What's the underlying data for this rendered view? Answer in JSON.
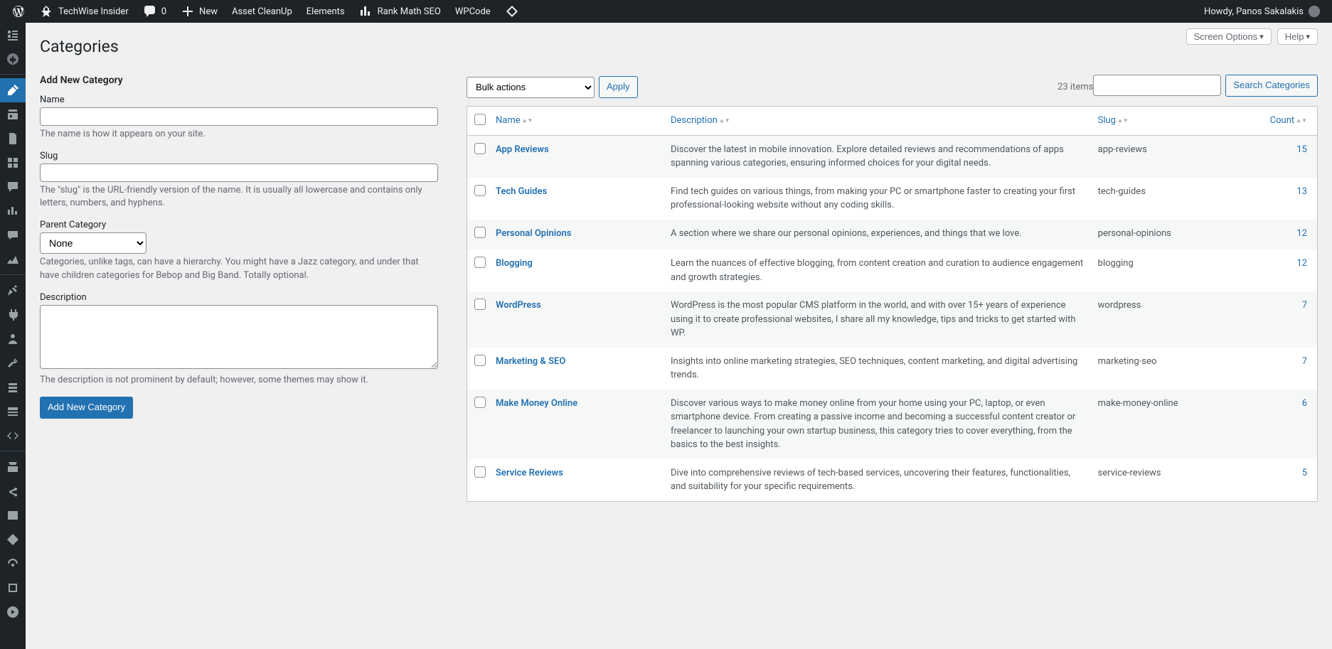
{
  "adminbar": {
    "site": "TechWise Insider",
    "comments": "0",
    "new": "New",
    "asset_cleanup": "Asset CleanUp",
    "elements": "Elements",
    "rankmath": "Rank Math SEO",
    "wpcode": "WPCode",
    "howdy": "Howdy, Panos Sakalakis"
  },
  "screen": {
    "options": "Screen Options",
    "help": "Help"
  },
  "page": {
    "title": "Categories",
    "search_btn": "Search Categories",
    "items_count": "23 items"
  },
  "form": {
    "heading": "Add New Category",
    "name_label": "Name",
    "name_desc": "The name is how it appears on your site.",
    "slug_label": "Slug",
    "slug_desc": "The \"slug\" is the URL-friendly version of the name. It is usually all lowercase and contains only letters, numbers, and hyphens.",
    "parent_label": "Parent Category",
    "parent_value": "None",
    "parent_desc": "Categories, unlike tags, can have a hierarchy. You might have a Jazz category, and under that have children categories for Bebop and Big Band. Totally optional.",
    "desc_label": "Description",
    "desc_desc": "The description is not prominent by default; however, some themes may show it.",
    "submit": "Add New Category"
  },
  "bulk": {
    "select": "Bulk actions",
    "apply": "Apply"
  },
  "cols": {
    "name": "Name",
    "description": "Description",
    "slug": "Slug",
    "count": "Count"
  },
  "rows": [
    {
      "name": "App Reviews",
      "desc": "Discover the latest in mobile innovation. Explore detailed reviews and recommendations of apps spanning various categories, ensuring informed choices for your digital needs.",
      "slug": "app-reviews",
      "count": "15"
    },
    {
      "name": "Tech Guides",
      "desc": "Find tech guides on various things, from making your PC or smartphone faster to creating your first professional-looking website without any coding skills.",
      "slug": "tech-guides",
      "count": "13"
    },
    {
      "name": "Personal Opinions",
      "desc": "A section where we share our personal opinions, experiences, and things that we love.",
      "slug": "personal-opinions",
      "count": "12"
    },
    {
      "name": "Blogging",
      "desc": "Learn the nuances of effective blogging, from content creation and curation to audience engagement and growth strategies.",
      "slug": "blogging",
      "count": "12"
    },
    {
      "name": "WordPress",
      "desc": "WordPress is the most popular CMS platform in the world, and with over 15+ years of experience using it to create professional websites, I share all my knowledge, tips and tricks to get started with WP.",
      "slug": "wordpress",
      "count": "7"
    },
    {
      "name": "Marketing & SEO",
      "desc": "Insights into online marketing strategies, SEO techniques, content marketing, and digital advertising trends.",
      "slug": "marketing-seo",
      "count": "7"
    },
    {
      "name": "Make Money Online",
      "desc": "Discover various ways to make money online from your home using your PC, laptop, or even smartphone device. From creating a passive income and becoming a successful content creator or freelancer to launching your own startup business, this category tries to cover everything, from the basics to the best insights.",
      "slug": "make-money-online",
      "count": "6"
    },
    {
      "name": "Service Reviews",
      "desc": "Dive into comprehensive reviews of tech-based services, uncovering their features, functionalities, and suitability for your specific requirements.",
      "slug": "service-reviews",
      "count": "5"
    }
  ]
}
